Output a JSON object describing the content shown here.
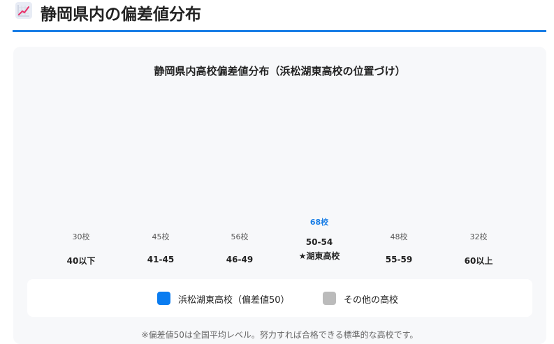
{
  "header": {
    "icon": "chart-increasing-icon",
    "title": "静岡県内の偏差値分布",
    "accent_color": "#1a7ee6"
  },
  "chart": {
    "title": "静岡県内高校偏差値分布（浜松湖東高校の位置づけ）",
    "legend": {
      "highlight_label": "浜松湖東高校（偏差値50）",
      "highlight_color": "#0a7cf0",
      "other_label": "その他の高校",
      "other_color": "#bbbbbb"
    },
    "footnote": "※偏差値50は全国平均レベル。努力すれば合格できる標準的な高校です。"
  },
  "chart_data": {
    "type": "bar",
    "title": "静岡県内高校偏差値分布（浜松湖東高校の位置づけ）",
    "categories": [
      "40以下",
      "41-45",
      "46-49",
      "50-54",
      "55-59",
      "60以上"
    ],
    "category_subtitles": [
      "",
      "",
      "",
      "★湖東高校",
      "",
      ""
    ],
    "value_labels": [
      "30校",
      "45校",
      "56校",
      "68校",
      "48校",
      "32校"
    ],
    "values": [
      30,
      45,
      56,
      68,
      48,
      32
    ],
    "highlight_index": 3,
    "series": [
      {
        "name": "浜松湖東高校（偏差値50）",
        "highlight": true
      },
      {
        "name": "その他の高校",
        "highlight": false
      }
    ]
  }
}
